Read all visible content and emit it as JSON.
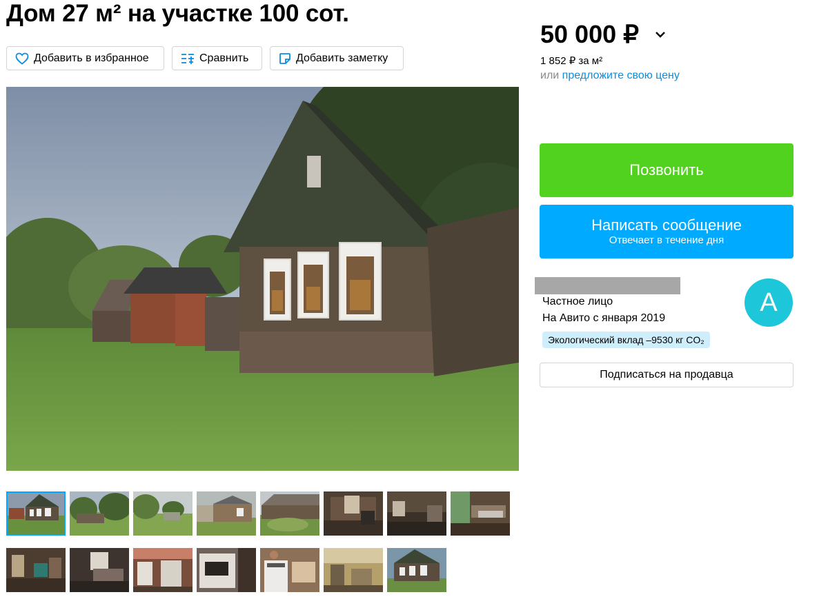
{
  "listing": {
    "title": "Дом 27 м² на участке 100 сот."
  },
  "actions": {
    "favorite_label": "Добавить в избранное",
    "compare_label": "Сравнить",
    "note_label": "Добавить заметку"
  },
  "price": {
    "value": "50 000 ₽",
    "per_sqm": "1 852 ₽ за м²",
    "offer_prefix": "или",
    "offer_link": "предложите свою цену"
  },
  "contact": {
    "call_label": "Позвонить",
    "message_label": "Написать сообщение",
    "message_sub": "Отвечает в течение дня"
  },
  "seller": {
    "type": "Частное лицо",
    "since": "На Авито с января 2019",
    "eco_badge": "Экологический вклад –9530 кг CO₂",
    "avatar_letter": "А",
    "subscribe_label": "Подписаться на продавца"
  },
  "gallery": {
    "thumbnail_count": 16,
    "active_index": 0
  },
  "colors": {
    "call_button": "#51d21e",
    "message_button": "#00aaff",
    "link": "#0a8de0",
    "avatar": "#1ec6da",
    "eco_badge_bg": "#cfeefc"
  },
  "icons": [
    "heart-icon",
    "compare-icon",
    "note-icon",
    "chevron-down-icon"
  ]
}
